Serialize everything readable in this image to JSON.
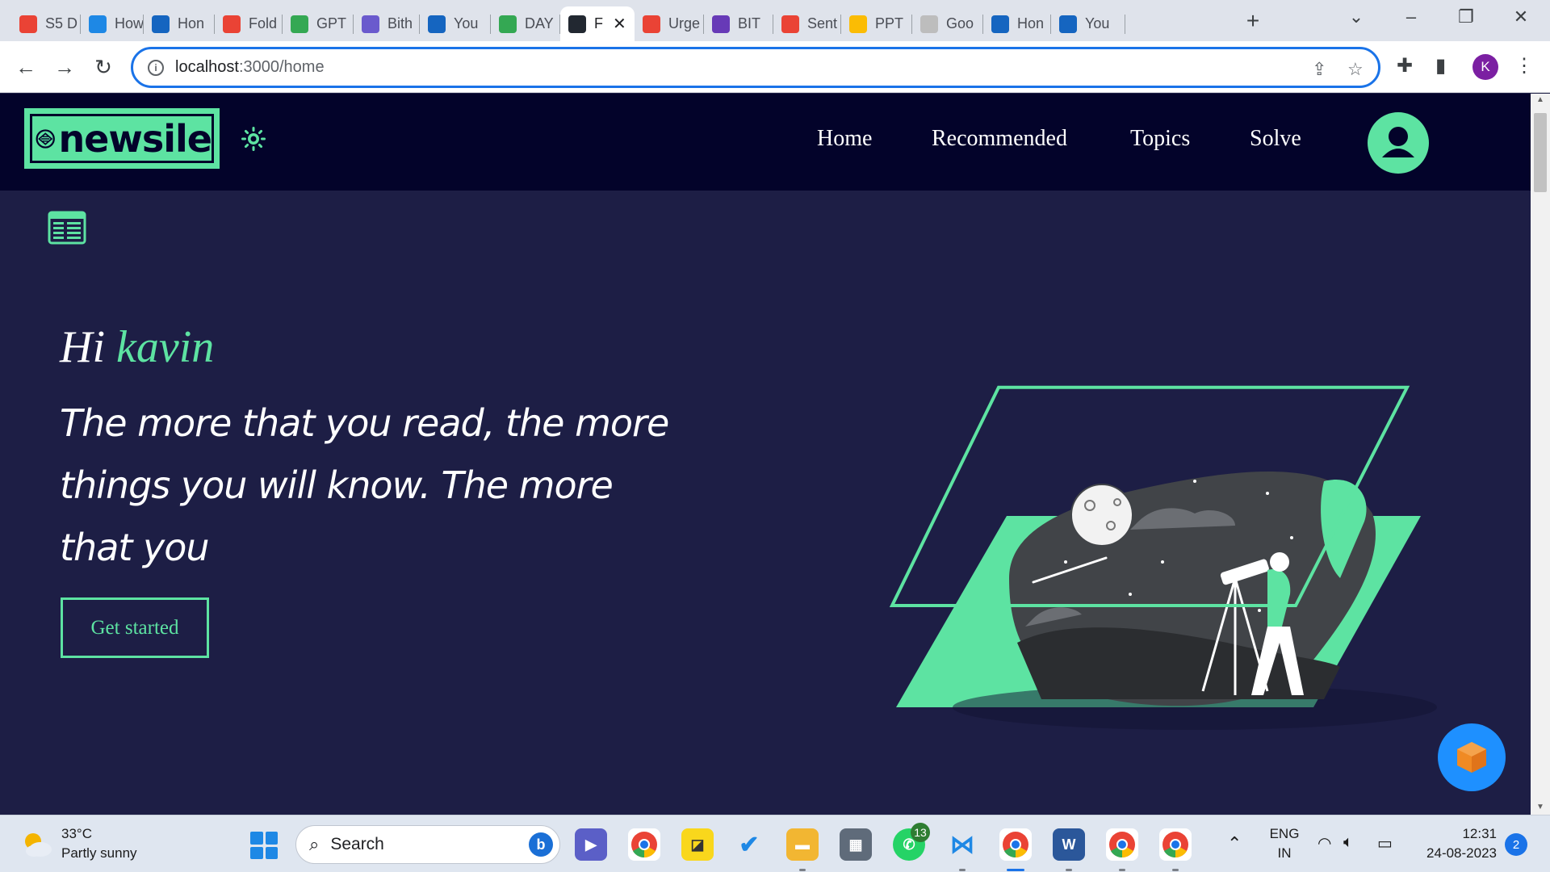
{
  "browser": {
    "tabs": [
      {
        "label": "S5 D",
        "icon": "gmail-icon",
        "color": "#ea4335"
      },
      {
        "label": "How",
        "icon": "refresh-logo-icon",
        "color": "#1e88e5"
      },
      {
        "label": "Hon",
        "icon": "c-logo-icon",
        "color": "#1565c0"
      },
      {
        "label": "Fold",
        "icon": "gmail-icon",
        "color": "#ea4335"
      },
      {
        "label": "GPT",
        "icon": "drive-icon",
        "color": "#34a853"
      },
      {
        "label": "Bith",
        "icon": "chatbot-icon",
        "color": "#6a5acd"
      },
      {
        "label": "You",
        "icon": "s-logo-icon",
        "color": "#1565c0"
      },
      {
        "label": "DAY",
        "icon": "drive-icon",
        "color": "#34a853"
      },
      {
        "label": "F",
        "icon": "react-icon",
        "color": "#222831",
        "active": true
      },
      {
        "label": "Urge",
        "icon": "gmail-icon",
        "color": "#ea4335"
      },
      {
        "label": "BIT",
        "icon": "forms-icon",
        "color": "#673ab7"
      },
      {
        "label": "Sent",
        "icon": "gmail-icon",
        "color": "#ea4335"
      },
      {
        "label": "PPT",
        "icon": "slides-icon",
        "color": "#fbbc04"
      },
      {
        "label": "Goo",
        "icon": "globe-icon",
        "color": "#bdbdbd"
      },
      {
        "label": "Hon",
        "icon": "c-logo-icon",
        "color": "#1565c0"
      },
      {
        "label": "You",
        "icon": "s-logo-icon",
        "color": "#1565c0"
      }
    ],
    "new_tab_label": "+",
    "tab_close_label": "✕",
    "url_host": "localhost",
    "url_path": ":3000/home",
    "profile_initial": "K"
  },
  "app": {
    "logo_text": "newsile",
    "nav": [
      "Home",
      "Recommended",
      "Topics",
      "Solve"
    ],
    "hero": {
      "greeting": "Hi",
      "user_name": "kavin",
      "quote": "The more that you read, the more things you will know. The more that you",
      "cta_label": "Get started"
    },
    "colors": {
      "accent": "#5de3a2",
      "background": "#1d1e45",
      "header": "#03032a",
      "fab": "#1e90ff"
    }
  },
  "taskbar": {
    "weather_temp": "33°C",
    "weather_desc": "Partly sunny",
    "search_label": "Search",
    "whatsapp_badge": "13",
    "language_line1": "ENG",
    "language_line2": "IN",
    "time": "12:31",
    "date": "24-08-2023",
    "notifications": "2"
  }
}
